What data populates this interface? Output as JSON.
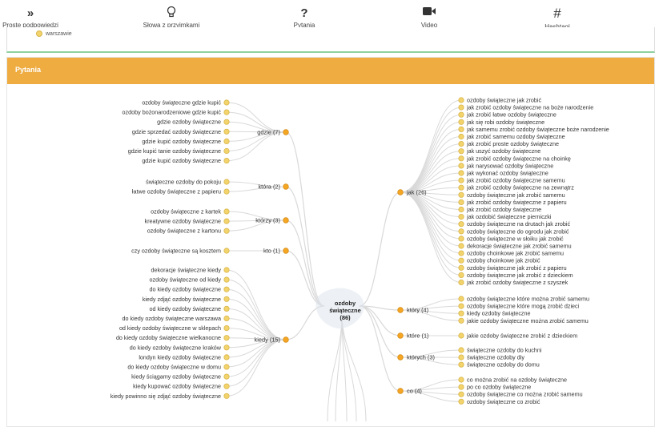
{
  "nav": [
    {
      "icon": "double-chevron-right-icon",
      "glyph": "»",
      "label": "Proste podpowiedzi"
    },
    {
      "icon": "lightbulb-icon",
      "glyph": "💡",
      "label": "Słowa z przyimkami"
    },
    {
      "icon": "question-icon",
      "glyph": "?",
      "label": "Pytania"
    },
    {
      "icon": "video-camera-icon",
      "glyph": "■",
      "label": "Video"
    },
    {
      "icon": "hashtag-icon",
      "glyph": "#",
      "label": "Hashtagi"
    }
  ],
  "previous_panel": {
    "item": "warszawie"
  },
  "panel": {
    "title": "Pytania"
  },
  "colors": {
    "accent": "#eeac41",
    "node": "#f3d36b",
    "node_hub": "#f5a623",
    "link": "#d9d9d9"
  },
  "root": {
    "line1": "ozdoby",
    "line2": "świąteczne",
    "count": "(86)"
  },
  "left_groups": [
    {
      "label": "gdzie (7)",
      "items": [
        "ozdoby świąteczne gdzie kupić",
        "ozdoby bożonarodzeniowe gdzie kupić",
        "gdzie ozdoby świąteczne",
        "gdzie sprzedać ozdoby świąteczne",
        "gdzie kupić ozdoby świąteczne",
        "gdzie kupić tanie ozdoby świąteczne",
        "gdzie kupić ozdoby świąteczne"
      ]
    },
    {
      "label": "która (2)",
      "items": [
        "świąteczne ozdoby do pokoju",
        "łatwe ozdoby świąteczne z papieru"
      ]
    },
    {
      "label": "którzy (3)",
      "items": [
        "ozdoby świąteczne z kartek",
        "kreatywne ozdoby świąteczne",
        "ozdoby świąteczne z kartonu"
      ]
    },
    {
      "label": "kto (1)",
      "items": [
        "czy ozdoby świąteczne są kosztem"
      ]
    },
    {
      "label": "kiedy (15)",
      "items": [
        "dekoracje świąteczne kiedy",
        "ozdoby świąteczne od kiedy",
        "do kiedy ozdoby świąteczne",
        "kiedy zdjąć ozdoby świąteczne",
        "od kiedy ozdoby świąteczne",
        "do kiedy ozdoby świąteczne warszawa",
        "od kiedy ozdoby świąteczne w sklepach",
        "do kiedy ozdoby świąteczne wielkanocne",
        "do kiedy ozdoby świąteczne kraków",
        "londyn kiedy ozdoby świąteczne",
        "do kiedy ozdoby świąteczne w domu",
        "kiedy ściągamy ozdoby świąteczne",
        "kiedy kupować ozdoby świąteczne",
        "kiedy powinno się zdjąć ozdoby świąteczne"
      ]
    }
  ],
  "right_groups": [
    {
      "label": "jak (26)",
      "items": [
        "ozdoby świąteczne jak zrobić",
        "jak zrobić ozdoby świąteczne na boże narodzenie",
        "jak zrobić łatwe ozdoby świąteczne",
        "jak się robi ozdoby świąteczne",
        "jak samemu zrobić ozdoby świąteczne boże narodzenie",
        "jak zrobić samemu ozdoby świąteczne",
        "jak zrobić proste ozdoby świąteczne",
        "jak uszyć ozdoby świąteczne",
        "jak zrobić ozdoby świąteczne na choinkę",
        "jak narysować ozdoby świąteczne",
        "jak wykonać ozdoby świąteczne",
        "jak zrobić ozdoby świąteczne samemu",
        "jak zrobić ozdoby świąteczne na zewnątrz",
        "ozdoby świąteczne jak zrobić samemu",
        "jak zrobić ozdoby świąteczne z papieru",
        "jak zrobić ozdoby świąteczne",
        "jak ozdobić świąteczne pierniczki",
        "ozdoby świąteczne na drutach jak zrobić",
        "ozdoby świąteczne do ogrodu jak zrobić",
        "ozdoby świąteczne w słoiku jak zrobić",
        "dekoracje świąteczne jak zrobić samemu",
        "ozdoby choinkowe jak zrobić samemu",
        "ozdoby choinkowe jak zrobić",
        "ozdoby świąteczne jak zrobić z papieru",
        "ozdoby świąteczne jak zrobić z dzieckiem",
        "jak zrobić ozdoby świąteczne z szyszek"
      ]
    },
    {
      "label": "który (4)",
      "items": [
        "ozdoby świąteczne które można zrobić samemu",
        "ozdoby świąteczne które mogą zrobić dzieci",
        "kiedy ozdoby świąteczne",
        "jakie ozdoby świąteczne można zrobić samemu"
      ]
    },
    {
      "label": "które (1)",
      "items": [
        "jakie ozdoby świąteczne zrobić z dzieckiem"
      ]
    },
    {
      "label": "których (3)",
      "items": [
        "świąteczne ozdoby do kuchni",
        "świąteczne ozdoby diy",
        "świąteczne ozdoby do domu"
      ]
    },
    {
      "label": "co (4)",
      "items": [
        "co można zrobić na ozdoby świąteczne",
        "po co ozdoby świąteczne",
        "ozdoby świąteczne co można zrobić samemu",
        "ozdoby świąteczne co zrobić"
      ]
    }
  ]
}
